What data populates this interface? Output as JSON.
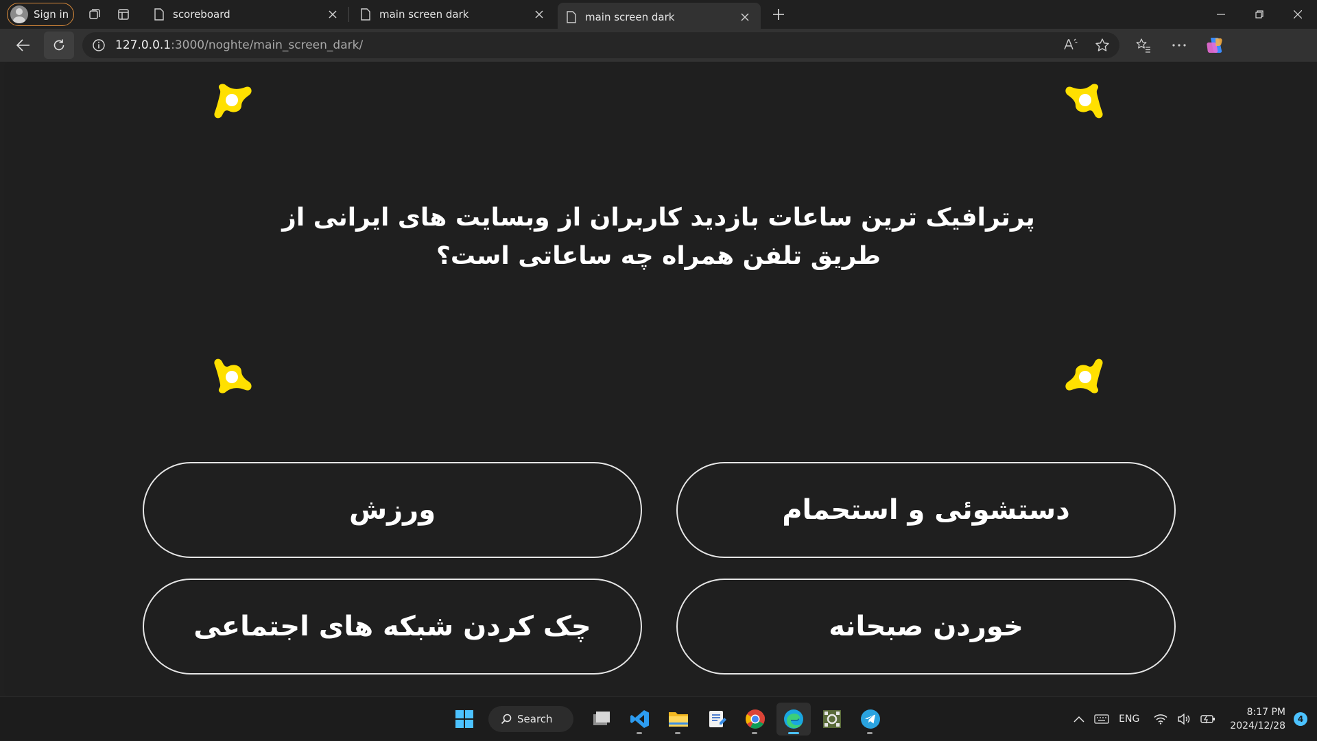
{
  "browser": {
    "profile_label": "Sign in",
    "tabs": [
      {
        "title": "scoreboard"
      },
      {
        "title": "main screen dark"
      },
      {
        "title": "main screen dark"
      }
    ],
    "url_host": "127.0.0.1",
    "url_path": ":3000/noghte/main_screen_dark/"
  },
  "quiz": {
    "question": "پرترافیک ترین ساعات بازدید کاربران از وبسایت های ایرانی از طریق تلفن همراه چه ساعاتی است؟",
    "answers": [
      "دستشوئی و استحمام",
      "ورزش",
      "خوردن صبحانه",
      "چک کردن شبکه های اجتماعی"
    ],
    "accent_color": "#FFE000"
  },
  "taskbar": {
    "search_label": "Search",
    "language": "ENG",
    "time": "8:17 PM",
    "date": "2024/12/28",
    "notification_count": "4"
  }
}
